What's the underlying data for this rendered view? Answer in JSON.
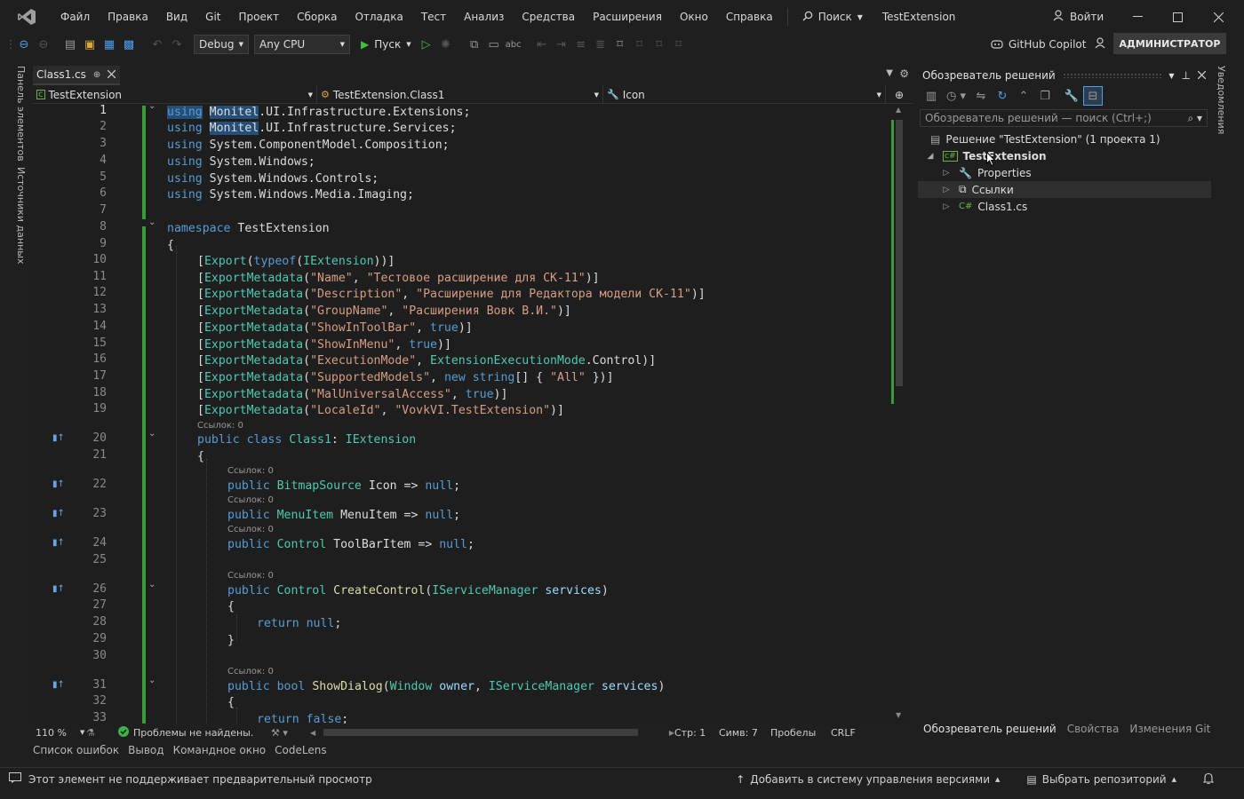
{
  "menubar": {
    "items": [
      "Файл",
      "Правка",
      "Вид",
      "Git",
      "Проект",
      "Сборка",
      "Отладка",
      "Тест",
      "Анализ",
      "Средства",
      "Расширения",
      "Окно",
      "Справка"
    ],
    "search": "Поиск",
    "title": "TestExtension",
    "signin": "Войти"
  },
  "toolbar": {
    "config": "Debug",
    "platform": "Any CPU",
    "run": "Пуск",
    "copilot": "GitHub Copilot",
    "admin": "АДМИНИСТРАТОР"
  },
  "left_strip": {
    "tab1": "Панель элементов",
    "tab2": "Источники данных"
  },
  "right_strip": {
    "tab1": "Уведомления"
  },
  "editor": {
    "tab_name": "Class1.cs",
    "nav_project": "TestExtension",
    "nav_class": "TestExtension.Class1",
    "nav_member": "Icon",
    "line_numbers": [
      "1",
      "2",
      "3",
      "4",
      "5",
      "6",
      "7",
      "8",
      "9",
      "10",
      "11",
      "12",
      "13",
      "14",
      "15",
      "16",
      "17",
      "18",
      "19",
      "20",
      "21",
      "22",
      "23",
      "24",
      "25",
      "26",
      "27",
      "28",
      "29",
      "30",
      "31",
      "32",
      "33"
    ],
    "lens": {
      "class": "Ссылок: 0",
      "icon": "Ссылок: 0",
      "menu": "Ссылок: 0",
      "toolbar": "Ссылок: 0",
      "create": "Ссылок: 0",
      "dialog": "Ссылок: 0"
    },
    "code": {
      "u1a": "using",
      "u1b": "Monitel",
      "u1c": ".UI.Infrastructure.Extensions;",
      "u2a": "using",
      "u2b": "Monitel",
      "u2c": ".UI.Infrastructure.Services;",
      "u3a": "using",
      "u3c": " System.ComponentModel.Composition;",
      "u4a": "using",
      "u4c": " System.Windows;",
      "u5a": "using",
      "u5c": " System.Windows.Controls;",
      "u6a": "using",
      "u6c": " System.Windows.Media.Imaging;",
      "ns_kw": "namespace",
      "ns_name": " TestExtension",
      "brace_open": "{",
      "brace_close": "}",
      "export_a": "[",
      "export_b": "Export",
      "export_c": "(",
      "export_d": "typeof",
      "export_e": "(",
      "export_f": "IExtension",
      "export_g": "))]",
      "em": "ExportMetadata",
      "m1k": "\"Name\"",
      "m1v": "\"Тестовое расширение для СК-11\"",
      "m2k": "\"Description\"",
      "m2v": "\"Расширение для Редактора модели СК-11\"",
      "m3k": "\"GroupName\"",
      "m3v": "\"Расширения Вовк В.И.\"",
      "m4k": "\"ShowInToolBar\"",
      "m4v": "true",
      "m5k": "\"ShowInMenu\"",
      "m5v": "true",
      "m6k": "\"ExecutionMode\"",
      "m6v": "ExtensionExecutionMode",
      "m6p": "Control",
      "m7k": "\"SupportedModels\"",
      "m7new": "new",
      "m7str": "string",
      "m7all": "\"All\"",
      "m8k": "\"MalUniversalAccess\"",
      "m8v": "true",
      "m9k": "\"LocaleId\"",
      "m9v": "\"VovkVI.TestExtension\"",
      "cls_pub": "public",
      "cls_class": "class",
      "cls_name": "Class1",
      "cls_iface": "IExtension",
      "p1_pub": "public",
      "p1_type": "BitmapSource",
      "p1_name": "Icon",
      "p1_null": "null",
      "p2_pub": "public",
      "p2_type": "MenuItem",
      "p2_name": "MenuItem",
      "p2_null": "null",
      "p3_pub": "public",
      "p3_type": "Control",
      "p3_name": "ToolBarItem",
      "p3_null": "null",
      "f1_pub": "public",
      "f1_type": "Control",
      "f1_name": "CreateControl",
      "f1_ptype": "IServiceManager",
      "f1_pname": "services",
      "ret_kw": "return",
      "ret_null": "null",
      "f2_pub": "public",
      "f2_bool": "bool",
      "f2_name": "ShowDialog",
      "f2_p1t": "Window",
      "f2_p1n": "owner",
      "f2_p2t": "IServiceManager",
      "f2_p2n": "services",
      "ret2_kw": "return",
      "ret2_false": "false"
    }
  },
  "edstatus": {
    "zoom": "110 %",
    "problems": "Проблемы не найдены.",
    "line": "Стр: 1",
    "col": "Симв: 7",
    "spaces": "Пробелы",
    "eol": "CRLF"
  },
  "bottom_tabs": [
    "Список ошибок",
    "Вывод",
    "Командное окно",
    "CodeLens"
  ],
  "statusbar": {
    "message": "Этот элемент не поддерживает предварительный просмотр",
    "add_vcs": "Добавить в систему управления версиями",
    "repo": "Выбрать репозиторий"
  },
  "solution_explorer": {
    "title": "Обозреватель решений",
    "search_placeholder": "Обозреватель решений — поиск (Ctrl+;)",
    "solution": "Решение \"TestExtension\" (1 проекта 1)",
    "project": "TestExtension",
    "items": [
      "Properties",
      "Ссылки",
      "Class1.cs"
    ],
    "tabs": [
      "Обозреватель решений",
      "Свойства",
      "Изменения Git"
    ]
  }
}
